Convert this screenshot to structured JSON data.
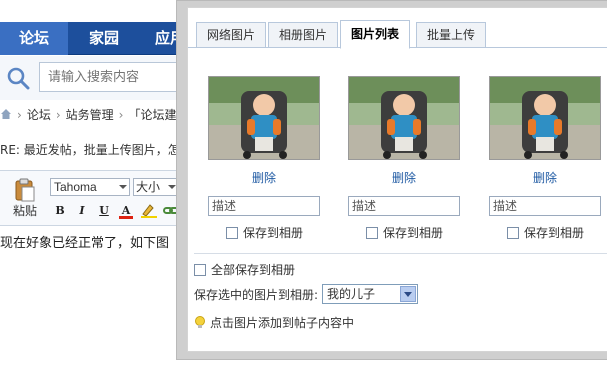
{
  "nav": {
    "items": [
      "论坛",
      "家园",
      "应用"
    ]
  },
  "search": {
    "placeholder": "请输入搜索内容"
  },
  "breadcrumb": {
    "items": [
      "论坛",
      "站务管理",
      "「论坛建"
    ]
  },
  "post": {
    "title": "RE: 最近发帖，批量上传图片，怎么"
  },
  "editor": {
    "paste_label": "粘贴",
    "font": "Tahoma",
    "size": "大小",
    "text": "现在好象已经正常了，如下图"
  },
  "dialog": {
    "tabs": [
      "网络图片",
      "相册图片",
      "图片列表",
      "批量上传"
    ],
    "active_tab": "图片列表",
    "photos": [
      {
        "delete_label": "删除",
        "desc_placeholder": "描述",
        "save_label": "保存到相册"
      },
      {
        "delete_label": "删除",
        "desc_placeholder": "描述",
        "save_label": "保存到相册"
      },
      {
        "delete_label": "删除",
        "desc_placeholder": "描述",
        "save_label": "保存到相册"
      }
    ],
    "save_all_label": "全部保存到相册",
    "save_to_label": "保存选中的图片到相册:",
    "album_selected": "我的儿子",
    "tip": "点击图片添加到帖子内容中"
  },
  "colors": {
    "nav_bg": "#1d4f9c",
    "link": "#1f5aa3",
    "dialog_border": "#cfcfcf"
  }
}
